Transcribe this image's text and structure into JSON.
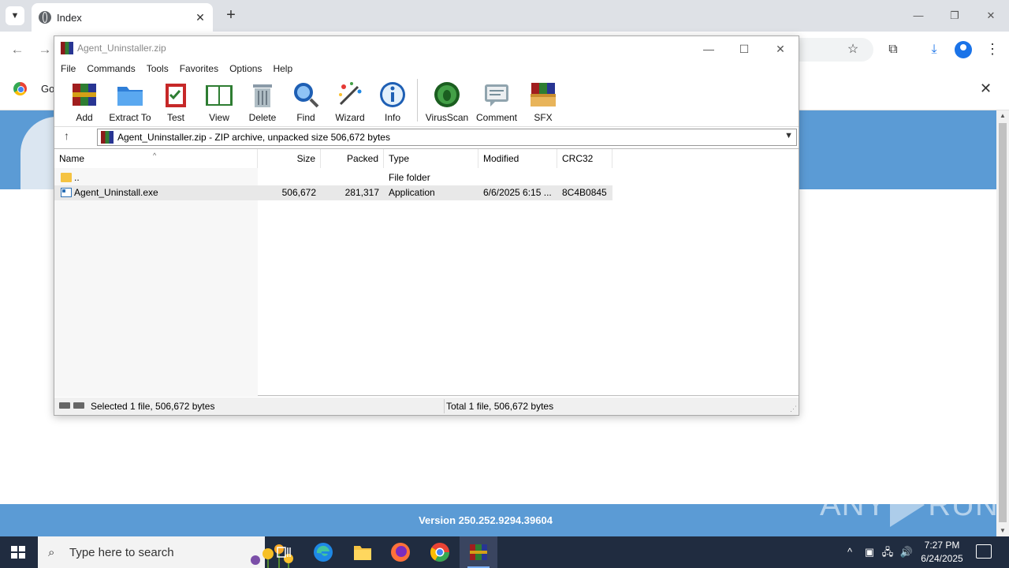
{
  "browser": {
    "tab_title": "Index",
    "info_text": "Go",
    "new_tab": "+",
    "close_tab": "✕"
  },
  "page": {
    "footer_version": "Version 250.252.9294.39604",
    "watermark_left": "ANY",
    "watermark_right": "RUN"
  },
  "winrar": {
    "title": "Agent_Uninstaller.zip",
    "menu": [
      "File",
      "Commands",
      "Tools",
      "Favorites",
      "Options",
      "Help"
    ],
    "toolbar": [
      {
        "label": "Add",
        "icon": "add-archive-icon"
      },
      {
        "label": "Extract To",
        "icon": "extract-folder-icon"
      },
      {
        "label": "Test",
        "icon": "test-clipboard-icon"
      },
      {
        "label": "View",
        "icon": "view-book-icon"
      },
      {
        "label": "Delete",
        "icon": "delete-trash-icon"
      },
      {
        "label": "Find",
        "icon": "find-magnifier-icon"
      },
      {
        "label": "Wizard",
        "icon": "wizard-wand-icon"
      },
      {
        "label": "Info",
        "icon": "info-icon"
      },
      {
        "label": "VirusScan",
        "icon": "virusscan-bug-icon"
      },
      {
        "label": "Comment",
        "icon": "comment-icon"
      },
      {
        "label": "SFX",
        "icon": "sfx-box-icon"
      }
    ],
    "address": "Agent_Uninstaller.zip - ZIP archive, unpacked size 506,672 bytes",
    "columns": [
      "Name",
      "Size",
      "Packed",
      "Type",
      "Modified",
      "CRC32"
    ],
    "rows": [
      {
        "name": "..",
        "size": "",
        "packed": "",
        "type": "File folder",
        "modified": "",
        "crc": "",
        "icon": "folder-icon"
      },
      {
        "name": "Agent_Uninstall.exe",
        "size": "506,672",
        "packed": "281,317",
        "type": "Application",
        "modified": "6/6/2025 6:15 ...",
        "crc": "8C4B0845",
        "icon": "application-exe-icon"
      }
    ],
    "status_left": "Selected 1 file, 506,672 bytes",
    "status_right": "Total 1 file, 506,672 bytes"
  },
  "taskbar": {
    "search_placeholder": "Type here to search",
    "time": "7:27 PM",
    "date": "6/24/2025"
  },
  "colors": {
    "page_blue": "#5b9bd5",
    "taskbar": "#202c40",
    "chrome_tabbar": "#dee1e6"
  }
}
